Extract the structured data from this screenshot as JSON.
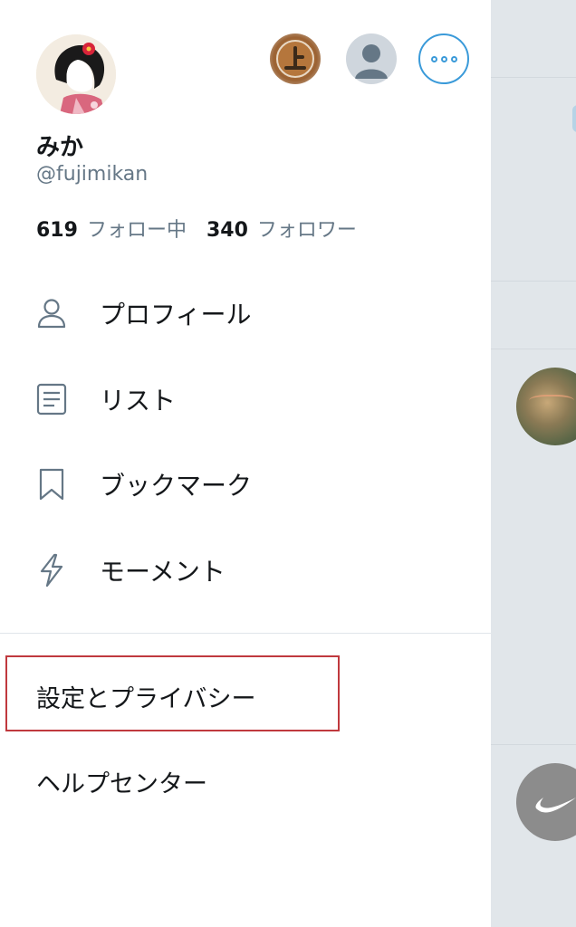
{
  "profile": {
    "display_name": "みか",
    "handle": "@fujimikan",
    "following_count": "619",
    "following_label": "フォロー中",
    "followers_count": "340",
    "followers_label": "フォロワー"
  },
  "menu": {
    "items": [
      {
        "label": "プロフィール",
        "icon": "person-icon"
      },
      {
        "label": "リスト",
        "icon": "list-icon"
      },
      {
        "label": "ブックマーク",
        "icon": "bookmark-icon"
      },
      {
        "label": "モーメント",
        "icon": "lightning-icon"
      }
    ],
    "settings_label": "設定とプライバシー",
    "help_label": "ヘルプセンター"
  },
  "colors": {
    "accent": "#1da1f2",
    "text": "#14171a",
    "secondary_text": "#657786",
    "highlight": "#c0393e"
  }
}
